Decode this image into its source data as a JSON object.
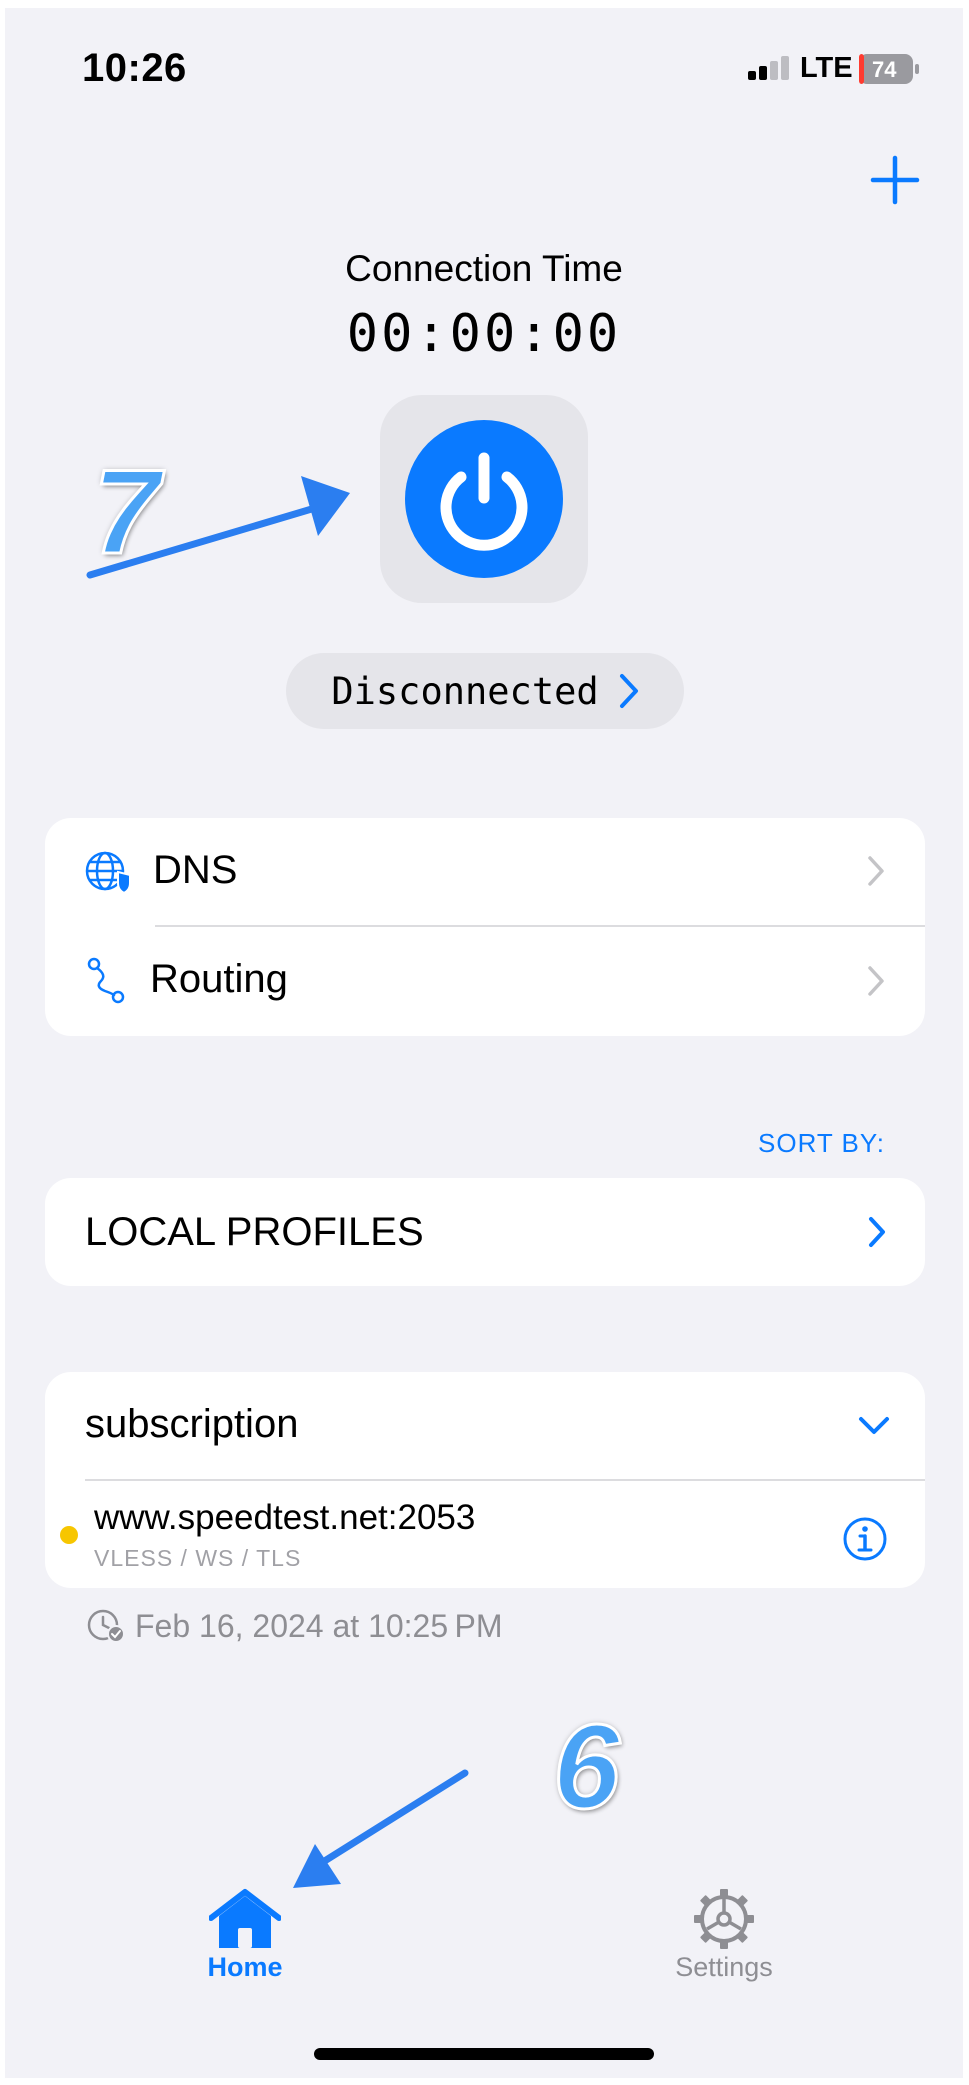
{
  "status_bar": {
    "time": "10:26",
    "network": "LTE",
    "battery": "74"
  },
  "connection": {
    "label": "Connection Time",
    "time": "00:00:00",
    "status": "Disconnected"
  },
  "settings_list": [
    {
      "label": "DNS"
    },
    {
      "label": "Routing"
    }
  ],
  "sort_by": "SORT BY:",
  "local_profiles": "LOCAL PROFILES",
  "subscription": {
    "title": "subscription",
    "server": {
      "name": "www.speedtest.net:2053",
      "protocol": "VLESS / WS / TLS"
    },
    "updated": "Feb 16, 2024 at 10:25 PM"
  },
  "annotations": {
    "step_top": "7",
    "step_bottom": "6"
  },
  "tab_bar": [
    {
      "label": "Home",
      "active": true
    },
    {
      "label": "Settings",
      "active": false
    }
  ],
  "colors": {
    "accent": "#0a7aff",
    "background": "#f2f2f7",
    "inactive": "#8e8e93",
    "status_dot": "#f7c600",
    "annotation": "#4aa3f5"
  },
  "icons": [
    "plus-icon",
    "power-icon",
    "chevron-right-icon",
    "globe-shield-icon",
    "route-icon",
    "chevron-down-icon",
    "info-icon",
    "clock-check-icon",
    "home-icon",
    "gear-icon"
  ]
}
